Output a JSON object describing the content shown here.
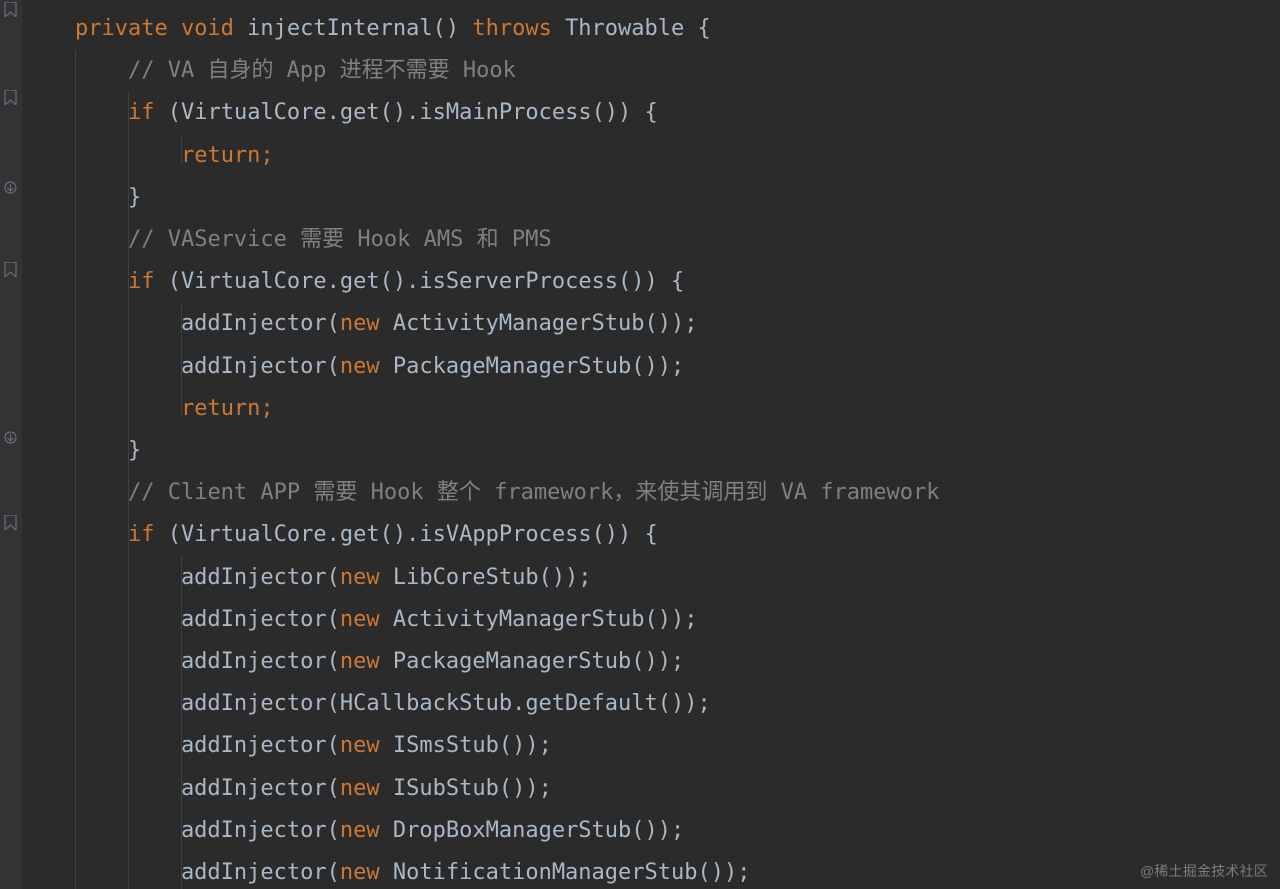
{
  "gutter": {
    "icons": [
      {
        "name": "gutter-marker-1",
        "kind": "bookmark",
        "topPx": 2
      },
      {
        "name": "gutter-marker-2",
        "kind": "bookmark",
        "topPx": 90
      },
      {
        "name": "gutter-marker-3",
        "kind": "override",
        "topPx": 180
      },
      {
        "name": "gutter-marker-4",
        "kind": "bookmark",
        "topPx": 262
      },
      {
        "name": "gutter-marker-5",
        "kind": "override",
        "topPx": 430
      },
      {
        "name": "gutter-marker-6",
        "kind": "bookmark",
        "topPx": 515
      }
    ]
  },
  "colors": {
    "background": "#2b2b2b",
    "gutter": "#313335",
    "default": "#a9b7c6",
    "keyword": "#cc7832",
    "comment": "#808080",
    "guide": "#3d4044"
  },
  "watermark": "@稀土掘金技术社区",
  "code": {
    "lines": [
      [
        {
          "cls": "t-default",
          "text": "    "
        },
        {
          "cls": "t-keyword",
          "text": "private void "
        },
        {
          "cls": "t-default",
          "text": "injectInternal() "
        },
        {
          "cls": "t-keyword",
          "text": "throws "
        },
        {
          "cls": "t-default",
          "text": "Throwable {"
        }
      ],
      [
        {
          "cls": "t-default",
          "text": "        "
        },
        {
          "cls": "t-comment",
          "text": "// VA 自身的 App 进程不需要 Hook"
        }
      ],
      [
        {
          "cls": "t-default",
          "text": "        "
        },
        {
          "cls": "t-keyword",
          "text": "if "
        },
        {
          "cls": "t-default",
          "text": "(VirtualCore.get().isMainProcess()) {"
        }
      ],
      [
        {
          "cls": "t-default",
          "text": "            "
        },
        {
          "cls": "t-keyword",
          "text": "return;"
        }
      ],
      [
        {
          "cls": "t-default",
          "text": "        }"
        }
      ],
      [
        {
          "cls": "t-default",
          "text": "        "
        },
        {
          "cls": "t-comment",
          "text": "// VAService 需要 Hook AMS 和 PMS"
        }
      ],
      [
        {
          "cls": "t-default",
          "text": "        "
        },
        {
          "cls": "t-keyword",
          "text": "if "
        },
        {
          "cls": "t-default",
          "text": "(VirtualCore.get().isServerProcess()) {"
        }
      ],
      [
        {
          "cls": "t-default",
          "text": "            addInjector("
        },
        {
          "cls": "t-keyword",
          "text": "new "
        },
        {
          "cls": "t-default",
          "text": "ActivityManagerStub());"
        }
      ],
      [
        {
          "cls": "t-default",
          "text": "            addInjector("
        },
        {
          "cls": "t-keyword",
          "text": "new "
        },
        {
          "cls": "t-default",
          "text": "PackageManagerStub());"
        }
      ],
      [
        {
          "cls": "t-default",
          "text": "            "
        },
        {
          "cls": "t-keyword",
          "text": "return;"
        }
      ],
      [
        {
          "cls": "t-default",
          "text": "        }"
        }
      ],
      [
        {
          "cls": "t-default",
          "text": "        "
        },
        {
          "cls": "t-comment",
          "text": "// Client APP 需要 Hook 整个 framework，来使其调用到 VA framework"
        }
      ],
      [
        {
          "cls": "t-default",
          "text": "        "
        },
        {
          "cls": "t-keyword",
          "text": "if "
        },
        {
          "cls": "t-default",
          "text": "(VirtualCore.get().isVAppProcess()) {"
        }
      ],
      [
        {
          "cls": "t-default",
          "text": "            addInjector("
        },
        {
          "cls": "t-keyword",
          "text": "new "
        },
        {
          "cls": "t-default",
          "text": "LibCoreStub());"
        }
      ],
      [
        {
          "cls": "t-default",
          "text": "            addInjector("
        },
        {
          "cls": "t-keyword",
          "text": "new "
        },
        {
          "cls": "t-default",
          "text": "ActivityManagerStub());"
        }
      ],
      [
        {
          "cls": "t-default",
          "text": "            addInjector("
        },
        {
          "cls": "t-keyword",
          "text": "new "
        },
        {
          "cls": "t-default",
          "text": "PackageManagerStub());"
        }
      ],
      [
        {
          "cls": "t-default",
          "text": "            addInjector(HCallbackStub.getDefault());"
        }
      ],
      [
        {
          "cls": "t-default",
          "text": "            addInjector("
        },
        {
          "cls": "t-keyword",
          "text": "new "
        },
        {
          "cls": "t-default",
          "text": "ISmsStub());"
        }
      ],
      [
        {
          "cls": "t-default",
          "text": "            addInjector("
        },
        {
          "cls": "t-keyword",
          "text": "new "
        },
        {
          "cls": "t-default",
          "text": "ISubStub());"
        }
      ],
      [
        {
          "cls": "t-default",
          "text": "            addInjector("
        },
        {
          "cls": "t-keyword",
          "text": "new "
        },
        {
          "cls": "t-default",
          "text": "DropBoxManagerStub());"
        }
      ],
      [
        {
          "cls": "t-default",
          "text": "            addInjector("
        },
        {
          "cls": "t-keyword",
          "text": "new "
        },
        {
          "cls": "t-default",
          "text": "NotificationManagerStub());"
        }
      ]
    ]
  }
}
